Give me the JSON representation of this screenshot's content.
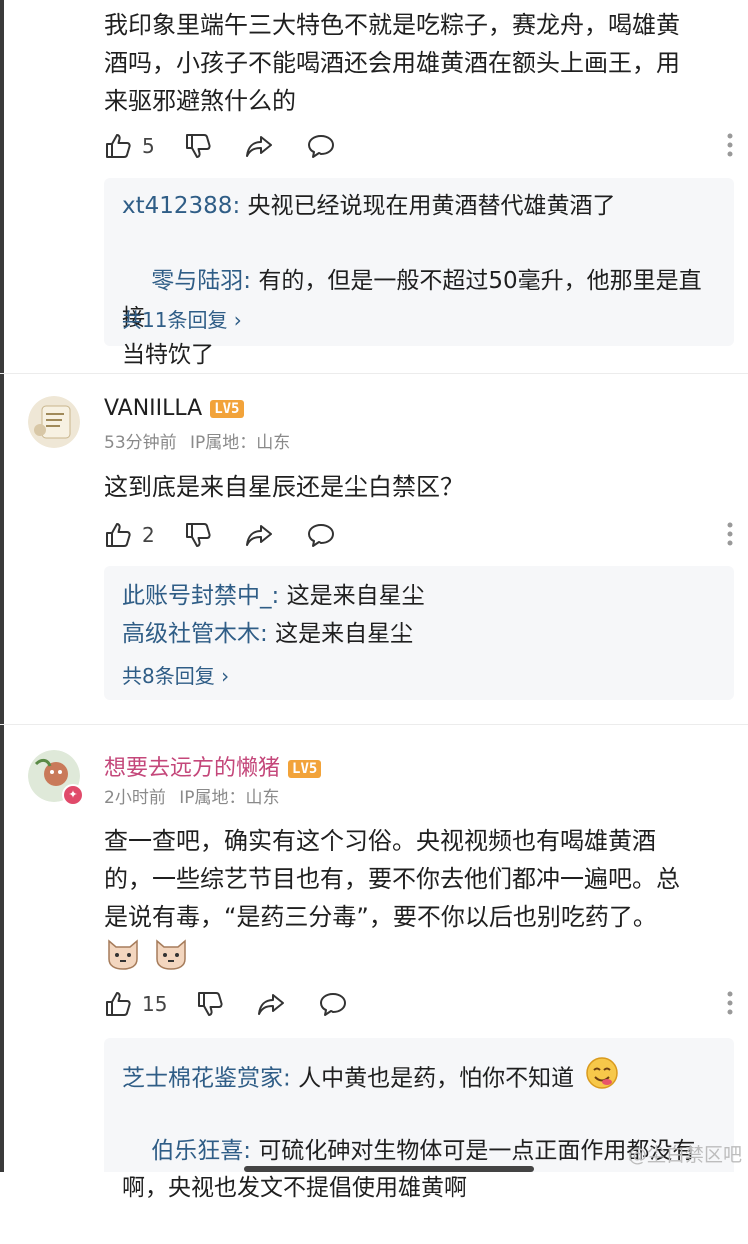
{
  "comments": [
    {
      "text": "我印象里端午三大特色不就是吃粽子，赛龙舟，喝雄黄\n酒吗，小孩子不能喝酒还会用雄黄酒在额头上画王，用\n来驱邪避煞什么的",
      "likes": "5",
      "replies": [
        {
          "name": "xt412388",
          "sep": ": ",
          "text": "央视已经说现在用黄酒替代雄黄酒了"
        },
        {
          "name": "零与陆羽",
          "sep": ": ",
          "text": "有的，但是一般不超过50毫升，他那里是直接\n当特饮了"
        }
      ],
      "more": "共11条回复 ›"
    },
    {
      "username": "VANIILLA",
      "level": "LV5",
      "time": "53分钟前",
      "ip": "IP属地：山东",
      "text": "这到底是来自星辰还是尘白禁区？",
      "likes": "2",
      "replies": [
        {
          "name": "此账号封禁中_",
          "sep": ": ",
          "text": "这是来自星尘"
        },
        {
          "name": "高级社管木木",
          "sep": ": ",
          "text": "这是来自星尘"
        }
      ],
      "more": "共8条回复 ›"
    },
    {
      "username": "想要去远方的懒猪",
      "level": "LV5",
      "time": "2小时前",
      "ip": "IP属地：山东",
      "text": "查一查吧，确实有这个习俗。央视视频也有喝雄黄酒\n的，一些综艺节目也有，要不你去他们都冲一遍吧。总\n是说有毒，“是药三分毒”，要不你以后也别吃药了。",
      "likes": "15",
      "replies": [
        {
          "name": "芝士棉花鉴赏家",
          "sep": ": ",
          "text": "人中黄也是药，怕你不知道"
        },
        {
          "name": "伯乐狂喜",
          "sep": ": ",
          "text": "可硫化砷对生物体可是一点正面作用都没有\n啊，央视也发文不提倡使用雄黄啊"
        }
      ]
    }
  ],
  "watermark": "@尘白禁区吧",
  "colors": {
    "link": "#2f5d86",
    "level_badge": "#f2a33a",
    "reply_bg": "#f6f7f9"
  }
}
